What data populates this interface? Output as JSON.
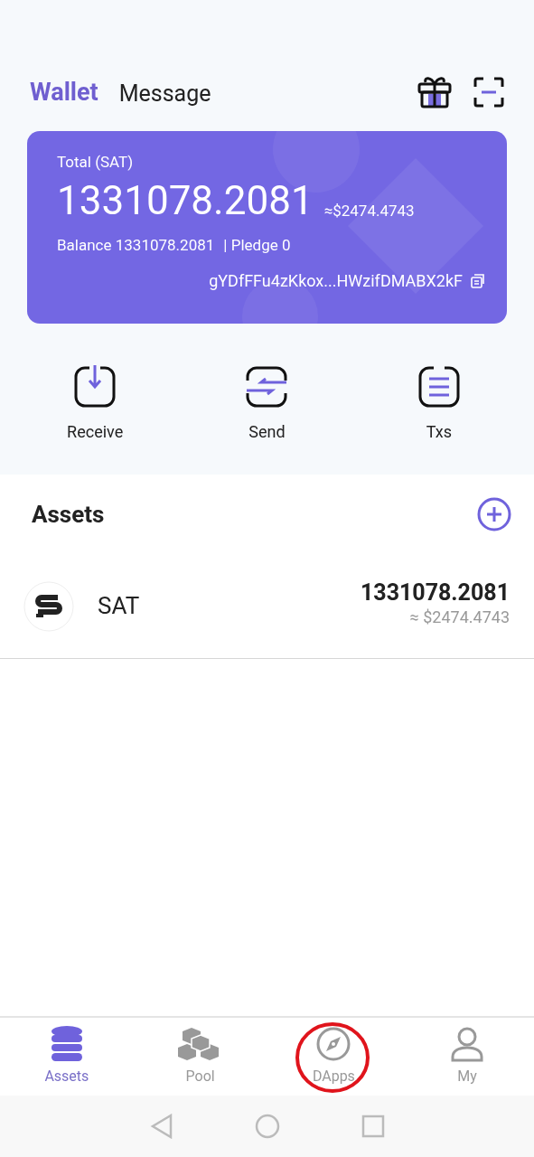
{
  "header_tabs": [
    {
      "label": "Wallet",
      "selected": true
    },
    {
      "label": "Message",
      "selected": false
    }
  ],
  "card": {
    "total_label": "Total (SAT)",
    "total": "1331078.2081",
    "fiat": "≈$2474.4743",
    "balance": "Balance 1331078.2081",
    "pledge": "| Pledge 0",
    "address": "gYDfFFu4zKkox...HWzifDMABX2kF"
  },
  "actions": [
    {
      "kind": "receive",
      "label": "Receive"
    },
    {
      "kind": "send",
      "label": "Send"
    },
    {
      "kind": "txs",
      "label": "Txs"
    }
  ],
  "assets": {
    "title": "Assets",
    "items": [
      {
        "symbol": "SAT",
        "amount": "1331078.2081",
        "fiat": "≈ $2474.4743"
      }
    ]
  },
  "bottom_nav": [
    {
      "kind": "assets",
      "label": "Assets",
      "selected": true,
      "highlighted": false
    },
    {
      "kind": "pool",
      "label": "Pool",
      "selected": false,
      "highlighted": false
    },
    {
      "kind": "dapps",
      "label": "DApps",
      "selected": false,
      "highlighted": true
    },
    {
      "kind": "my",
      "label": "My",
      "selected": false,
      "highlighted": false
    }
  ]
}
